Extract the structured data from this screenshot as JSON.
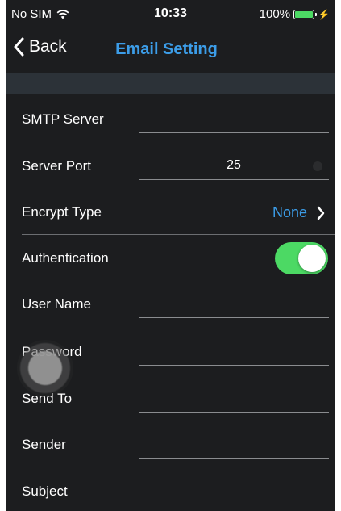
{
  "status_bar": {
    "carrier": "No SIM",
    "time": "10:33",
    "battery_text": "100%",
    "battery_level": 1.0,
    "battery_color": "#4cd964"
  },
  "nav": {
    "back_label": "Back",
    "title": "Email Setting",
    "accent_color": "#3c9de8"
  },
  "form": {
    "smtp_server": {
      "label": "SMTP Server",
      "value": ""
    },
    "server_port": {
      "label": "Server Port",
      "value": "25"
    },
    "encrypt_type": {
      "label": "Encrypt Type",
      "value": "None"
    },
    "authentication": {
      "label": "Authentication",
      "enabled": true,
      "toggle_color": "#4cd964"
    },
    "user_name": {
      "label": "User Name",
      "value": ""
    },
    "password": {
      "label": "Password",
      "value": ""
    },
    "send_to": {
      "label": "Send To",
      "value": ""
    },
    "sender": {
      "label": "Sender",
      "value": ""
    },
    "subject": {
      "label": "Subject",
      "value": ""
    }
  },
  "icons": {
    "wifi": "wifi-icon",
    "battery": "battery-icon",
    "charging": "charging-bolt-icon",
    "back": "chevron-left-icon",
    "disclosure": "chevron-right-icon"
  }
}
